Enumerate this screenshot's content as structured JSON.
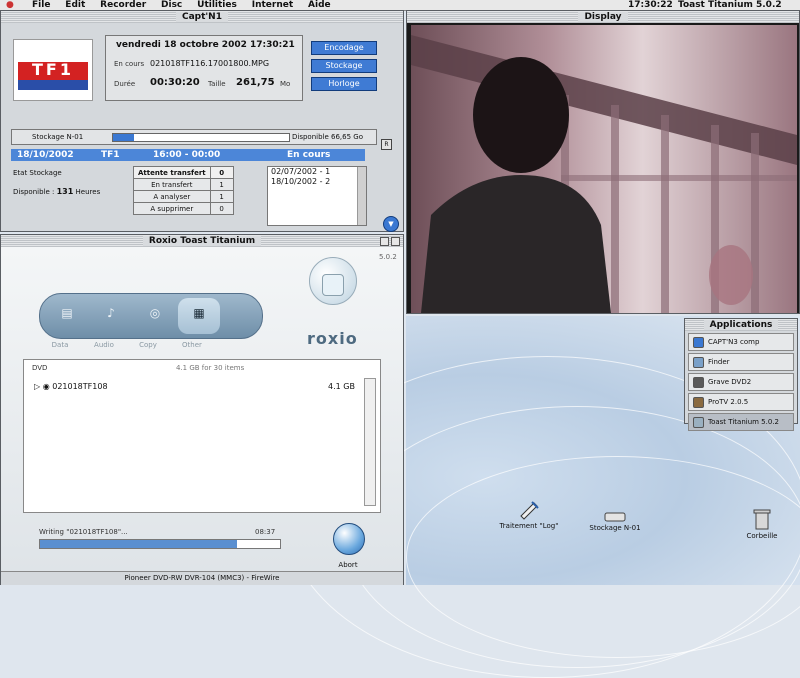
{
  "menubar": {
    "items": [
      "File",
      "Edit",
      "Recorder",
      "Disc",
      "Utilities",
      "Internet",
      "Aide"
    ],
    "clock": "17:30:22",
    "app": "Toast Titanium 5.0.2"
  },
  "captn": {
    "title": "Capt'N1",
    "logo_text": "TF1",
    "date": "vendredi 18 octobre 2002 17:30:21",
    "encours_label": "En cours",
    "encours_file": "021018TF116.17001800.MPG",
    "duree_label": "Durée",
    "duree": "00:30:20",
    "taille_label": "Taille",
    "taille": "261,75",
    "taille_unit": "Mo",
    "buttons": [
      "Encodage",
      "Stockage",
      "Horloge"
    ],
    "storage_label": "Stockage N-01",
    "storage_progress": 0.12,
    "storage_free": "Disponible 66,65 Go",
    "row_date": "18/10/2002",
    "row_channel": "TF1",
    "row_time": "16:00 - 00:00",
    "row_status": "En cours",
    "etat_label": "Etat Stockage",
    "dispo_label": "Disponible :",
    "dispo_value": "131",
    "dispo_unit": "Heures",
    "transfer_rows": [
      {
        "label": "Attente transfert",
        "count": "0"
      },
      {
        "label": "En transfert",
        "count": "1"
      },
      {
        "label": "A analyser",
        "count": "1"
      },
      {
        "label": "A supprimer",
        "count": "0"
      }
    ],
    "dates": [
      "02/07/2002 - 1",
      "18/10/2002 - 2"
    ]
  },
  "display": {
    "title": "Display"
  },
  "apps": {
    "title": "Applications",
    "items": [
      {
        "label": "CAPT'N3 comp",
        "color": "#3a78d2"
      },
      {
        "label": "Finder",
        "color": "#7aa0c8"
      },
      {
        "label": "Grave DVD2",
        "color": "#5a5a5a"
      },
      {
        "label": "ProTV 2.0.5",
        "color": "#8a6a40"
      },
      {
        "label": "Toast Titanium 5.0.2",
        "color": "#9ab0c0"
      }
    ]
  },
  "desktop": {
    "icons": [
      "Traitement \"Log\"",
      "Stockage N-01",
      "Corbeille"
    ]
  },
  "toast": {
    "title": "Roxio Toast Titanium",
    "version": "5.0.2",
    "tabs": [
      "Data",
      "Audio",
      "Copy",
      "Other"
    ],
    "brand": "roxio",
    "disc_label": "DVD",
    "disc_summary": "4.1 GB for 30 items",
    "item_name": "021018TF108",
    "item_size": "4.1 GB",
    "writing_text": "Writing \"021018TF108\"...",
    "writing_time": "08:37",
    "writing_progress": 0.82,
    "abort_label": "Abort",
    "device": "Pioneer DVD-RW  DVR-104 (MMC3) - FireWire"
  }
}
